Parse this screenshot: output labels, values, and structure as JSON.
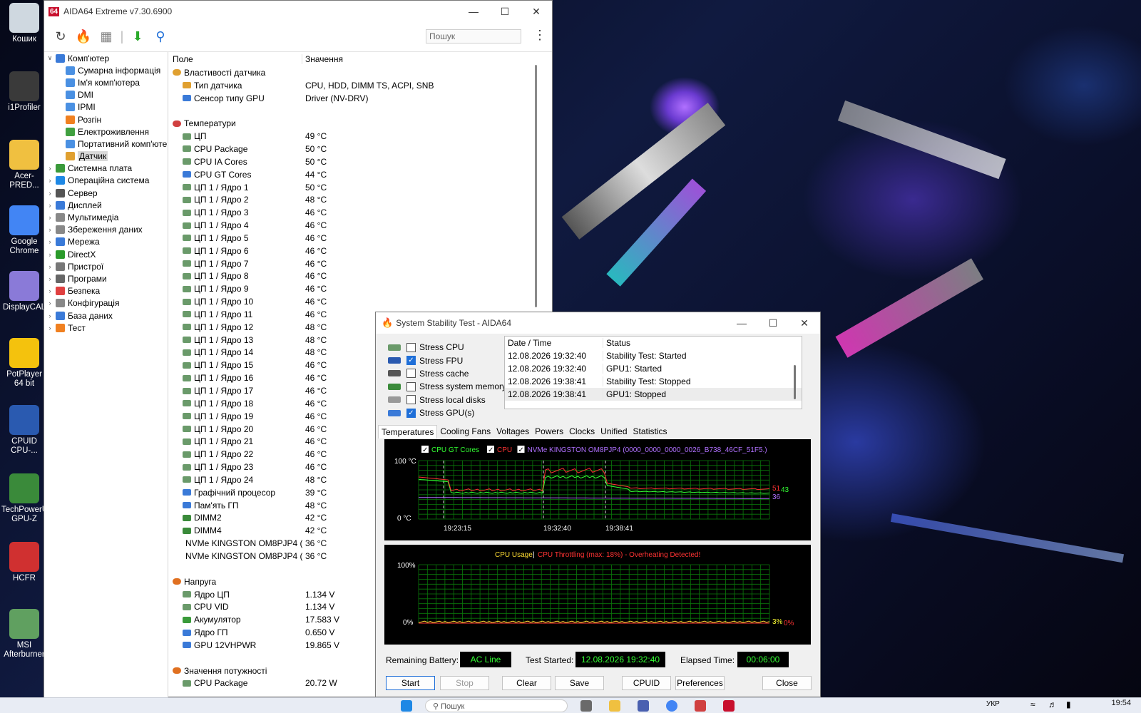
{
  "desktop": {
    "icons": [
      {
        "label": "Кошик",
        "color": "#cfd8e0",
        "icon": "recycle-bin-icon"
      },
      {
        "label": "i1Profiler",
        "color": "#3a3a3a",
        "icon": "i1profiler-icon"
      },
      {
        "label": "Acer-PRED...",
        "color": "#f0c040",
        "icon": "folder-icon"
      },
      {
        "label": "Google Chrome",
        "color": "#4285f4",
        "icon": "chrome-icon"
      },
      {
        "label": "DisplayCAL",
        "color": "#8a7ad8",
        "icon": "displaycal-icon"
      },
      {
        "label": "PotPlayer 64 bit",
        "color": "#f4c20d",
        "icon": "potplayer-icon"
      },
      {
        "label": "CPUID CPU-...",
        "color": "#2a5ab0",
        "icon": "cpuid-icon"
      },
      {
        "label": "TechPowerUp GPU-Z",
        "color": "#3a8a3a",
        "icon": "gpuz-icon"
      },
      {
        "label": "HCFR",
        "color": "#d03030",
        "icon": "hcfr-icon"
      },
      {
        "label": "MSI Afterburner",
        "color": "#60a060",
        "icon": "afterburner-icon"
      }
    ]
  },
  "aida": {
    "title": "AIDA64 Extreme v7.30.6900",
    "logo": "64",
    "search_placeholder": "Пошук",
    "tree": [
      {
        "label": "Комп'ютер",
        "level": 0,
        "expanded": true,
        "color": "#3a7ad8"
      },
      {
        "label": "Сумарна інформація",
        "level": 1,
        "color": "#4a90e2"
      },
      {
        "label": "Ім'я комп'ютера",
        "level": 1,
        "color": "#4a90e2"
      },
      {
        "label": "DMI",
        "level": 1,
        "color": "#4a90e2"
      },
      {
        "label": "IPMI",
        "level": 1,
        "color": "#4a90e2"
      },
      {
        "label": "Розгін",
        "level": 1,
        "color": "#f08020"
      },
      {
        "label": "Електроживлення",
        "level": 1,
        "color": "#40a040"
      },
      {
        "label": "Портативний комп'юте",
        "level": 1,
        "color": "#4a90e2"
      },
      {
        "label": "Датчик",
        "level": 1,
        "color": "#e0a030",
        "selected": true
      },
      {
        "label": "Системна плата",
        "level": 0,
        "color": "#3a9a3a"
      },
      {
        "label": "Операційна система",
        "level": 0,
        "color": "#1e88e5"
      },
      {
        "label": "Сервер",
        "level": 0,
        "color": "#555555"
      },
      {
        "label": "Дисплей",
        "level": 0,
        "color": "#3a7ad8"
      },
      {
        "label": "Мультимедіа",
        "level": 0,
        "color": "#888888"
      },
      {
        "label": "Збереження даних",
        "level": 0,
        "color": "#888888"
      },
      {
        "label": "Мережа",
        "level": 0,
        "color": "#3a7ad8"
      },
      {
        "label": "DirectX",
        "level": 0,
        "color": "#2a9a2a"
      },
      {
        "label": "Пристрої",
        "level": 0,
        "color": "#777777"
      },
      {
        "label": "Програми",
        "level": 0,
        "color": "#666666"
      },
      {
        "label": "Безпека",
        "level": 0,
        "color": "#e04040"
      },
      {
        "label": "Конфігурація",
        "level": 0,
        "color": "#888888"
      },
      {
        "label": "База даних",
        "level": 0,
        "color": "#3a7ad8"
      },
      {
        "label": "Тест",
        "level": 0,
        "color": "#f08020"
      }
    ],
    "columns": {
      "field": "Поле",
      "value": "Значення"
    },
    "rows": [
      {
        "t": "section",
        "f": "Властивості датчика",
        "v": "",
        "c": "#e0a030"
      },
      {
        "t": "item",
        "f": "Тип датчика",
        "v": "CPU, HDD, DIMM TS, ACPI, SNB",
        "c": "#e0a030"
      },
      {
        "t": "item",
        "f": "Сенсор типу GPU",
        "v": "Driver  (NV-DRV)",
        "c": "#3a7ad8"
      },
      {
        "t": "blank",
        "f": "",
        "v": ""
      },
      {
        "t": "section",
        "f": "Температури",
        "v": "",
        "c": "#d04040"
      },
      {
        "t": "item",
        "f": "ЦП",
        "v": "49 °C",
        "c": "#6a9a6a"
      },
      {
        "t": "item",
        "f": "CPU Package",
        "v": "50 °C",
        "c": "#6a9a6a"
      },
      {
        "t": "item",
        "f": "CPU IA Cores",
        "v": "50 °C",
        "c": "#6a9a6a"
      },
      {
        "t": "item",
        "f": "CPU GT Cores",
        "v": "44 °C",
        "c": "#3a7ad8"
      },
      {
        "t": "item",
        "f": "ЦП 1 / Ядро 1",
        "v": "50 °C",
        "c": "#6a9a6a"
      },
      {
        "t": "item",
        "f": "ЦП 1 / Ядро 2",
        "v": "48 °C",
        "c": "#6a9a6a"
      },
      {
        "t": "item",
        "f": "ЦП 1 / Ядро 3",
        "v": "46 °C",
        "c": "#6a9a6a"
      },
      {
        "t": "item",
        "f": "ЦП 1 / Ядро 4",
        "v": "46 °C",
        "c": "#6a9a6a"
      },
      {
        "t": "item",
        "f": "ЦП 1 / Ядро 5",
        "v": "46 °C",
        "c": "#6a9a6a"
      },
      {
        "t": "item",
        "f": "ЦП 1 / Ядро 6",
        "v": "46 °C",
        "c": "#6a9a6a"
      },
      {
        "t": "item",
        "f": "ЦП 1 / Ядро 7",
        "v": "46 °C",
        "c": "#6a9a6a"
      },
      {
        "t": "item",
        "f": "ЦП 1 / Ядро 8",
        "v": "46 °C",
        "c": "#6a9a6a"
      },
      {
        "t": "item",
        "f": "ЦП 1 / Ядро 9",
        "v": "46 °C",
        "c": "#6a9a6a"
      },
      {
        "t": "item",
        "f": "ЦП 1 / Ядро 10",
        "v": "46 °C",
        "c": "#6a9a6a"
      },
      {
        "t": "item",
        "f": "ЦП 1 / Ядро 11",
        "v": "46 °C",
        "c": "#6a9a6a"
      },
      {
        "t": "item",
        "f": "ЦП 1 / Ядро 12",
        "v": "48 °C",
        "c": "#6a9a6a"
      },
      {
        "t": "item",
        "f": "ЦП 1 / Ядро 13",
        "v": "48 °C",
        "c": "#6a9a6a"
      },
      {
        "t": "item",
        "f": "ЦП 1 / Ядро 14",
        "v": "48 °C",
        "c": "#6a9a6a"
      },
      {
        "t": "item",
        "f": "ЦП 1 / Ядро 15",
        "v": "46 °C",
        "c": "#6a9a6a"
      },
      {
        "t": "item",
        "f": "ЦП 1 / Ядро 16",
        "v": "46 °C",
        "c": "#6a9a6a"
      },
      {
        "t": "item",
        "f": "ЦП 1 / Ядро 17",
        "v": "46 °C",
        "c": "#6a9a6a"
      },
      {
        "t": "item",
        "f": "ЦП 1 / Ядро 18",
        "v": "46 °C",
        "c": "#6a9a6a"
      },
      {
        "t": "item",
        "f": "ЦП 1 / Ядро 19",
        "v": "46 °C",
        "c": "#6a9a6a"
      },
      {
        "t": "item",
        "f": "ЦП 1 / Ядро 20",
        "v": "46 °C",
        "c": "#6a9a6a"
      },
      {
        "t": "item",
        "f": "ЦП 1 / Ядро 21",
        "v": "46 °C",
        "c": "#6a9a6a"
      },
      {
        "t": "item",
        "f": "ЦП 1 / Ядро 22",
        "v": "46 °C",
        "c": "#6a9a6a"
      },
      {
        "t": "item",
        "f": "ЦП 1 / Ядро 23",
        "v": "46 °C",
        "c": "#6a9a6a"
      },
      {
        "t": "item",
        "f": "ЦП 1 / Ядро 24",
        "v": "48 °C",
        "c": "#6a9a6a"
      },
      {
        "t": "item",
        "f": "Графічний процесор",
        "v": "39 °C",
        "c": "#3a7ad8"
      },
      {
        "t": "item",
        "f": "Пам'ять ГП",
        "v": "48 °C",
        "c": "#3a7ad8"
      },
      {
        "t": "item",
        "f": "DIMM2",
        "v": "42 °C",
        "c": "#3a8a3a"
      },
      {
        "t": "item",
        "f": "DIMM4",
        "v": "42 °C",
        "c": "#3a8a3a"
      },
      {
        "t": "item",
        "f": "NVMe KINGSTON OM8PJP4 (...",
        "v": "36 °C",
        "c": "#999999"
      },
      {
        "t": "item",
        "f": "NVMe KINGSTON OM8PJP4 (...",
        "v": "36 °C",
        "c": "#999999"
      },
      {
        "t": "blank",
        "f": "",
        "v": ""
      },
      {
        "t": "section",
        "f": "Напруга",
        "v": "",
        "c": "#e07020"
      },
      {
        "t": "item",
        "f": "Ядро ЦП",
        "v": "1.134 V",
        "c": "#6a9a6a"
      },
      {
        "t": "item",
        "f": "CPU VID",
        "v": "1.134 V",
        "c": "#6a9a6a"
      },
      {
        "t": "item",
        "f": "Акумулятор",
        "v": "17.583 V",
        "c": "#3a9a3a"
      },
      {
        "t": "item",
        "f": "Ядро ГП",
        "v": "0.650 V",
        "c": "#3a7ad8"
      },
      {
        "t": "item",
        "f": "GPU 12VHPWR",
        "v": "19.865 V",
        "c": "#3a7ad8"
      },
      {
        "t": "blank",
        "f": "",
        "v": ""
      },
      {
        "t": "section",
        "f": "Значення потужності",
        "v": "",
        "c": "#e07020"
      },
      {
        "t": "item",
        "f": "CPU Package",
        "v": "20.72 W",
        "c": "#6a9a6a"
      }
    ]
  },
  "sst": {
    "title": "System Stability Test - AIDA64",
    "stress": [
      {
        "label": "Stress CPU",
        "checked": false,
        "c": "#6a9a6a"
      },
      {
        "label": "Stress FPU",
        "checked": true,
        "c": "#2a5ab0"
      },
      {
        "label": "Stress cache",
        "checked": false,
        "c": "#555555"
      },
      {
        "label": "Stress system memory",
        "checked": false,
        "c": "#3a8a3a"
      },
      {
        "label": "Stress local disks",
        "checked": false,
        "c": "#999999"
      },
      {
        "label": "Stress GPU(s)",
        "checked": true,
        "c": "#3a7ad8"
      }
    ],
    "log_headers": {
      "date": "Date / Time",
      "status": "Status"
    },
    "log": [
      {
        "date": "12.08.2026 19:32:40",
        "status": "Stability Test: Started"
      },
      {
        "date": "12.08.2026 19:32:40",
        "status": "GPU1: Started"
      },
      {
        "date": "12.08.2026 19:38:41",
        "status": "Stability Test: Stopped"
      },
      {
        "date": "12.08.2026 19:38:41",
        "status": "GPU1: Stopped"
      }
    ],
    "tabs": [
      "Temperatures",
      "Cooling Fans",
      "Voltages",
      "Powers",
      "Clocks",
      "Unified",
      "Statistics"
    ],
    "temp_legend": [
      {
        "label": "CPU GT Cores",
        "color": "#33ff33"
      },
      {
        "label": "CPU",
        "color": "#ff3333"
      },
      {
        "label": "NVMe KINGSTON OM8PJP4 (0000_0000_0000_0026_B738_46CF_51F5.)",
        "color": "#b070ff"
      }
    ],
    "temp_ymax_label": "100 °C",
    "temp_ymin_label": "0 °C",
    "temp_times": [
      "19:23:15",
      "19:32:40",
      "19:38:41"
    ],
    "temp_end_values": [
      {
        "label": "51",
        "color": "#ff3333"
      },
      {
        "label": "43",
        "color": "#33ff33"
      },
      {
        "label": "36",
        "color": "#b070ff"
      }
    ],
    "usage_title": "CPU Usage",
    "usage_sep": "|",
    "usage_throttle": "CPU Throttling (max: 18%) - Overheating Detected!",
    "usage_ymax_label": "100%",
    "usage_ymin_label": "0%",
    "usage_end_values": [
      {
        "label": "3%",
        "color": "#ffff33"
      },
      {
        "label": "0%",
        "color": "#ff3333"
      }
    ],
    "status": {
      "battery_label": "Remaining Battery:",
      "battery": "AC Line",
      "started_label": "Test Started:",
      "started": "12.08.2026 19:32:40",
      "elapsed_label": "Elapsed Time:",
      "elapsed": "00:06:00"
    },
    "buttons": {
      "start": "Start",
      "stop": "Stop",
      "clear": "Clear",
      "save": "Save",
      "cpuid": "CPUID",
      "preferences": "Preferences",
      "close": "Close"
    }
  },
  "taskbar": {
    "search": "Пошук",
    "lang": "УКР",
    "time": "19:54"
  }
}
